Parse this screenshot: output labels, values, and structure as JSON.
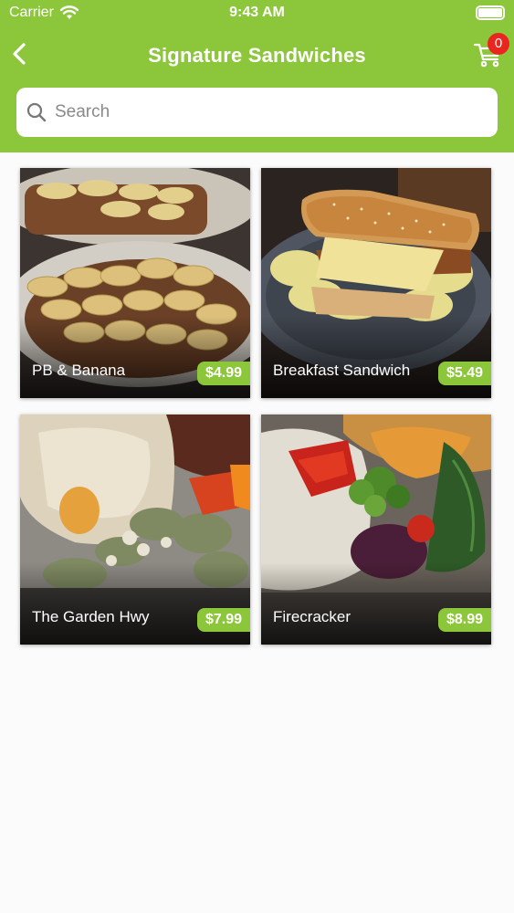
{
  "status_bar": {
    "carrier": "Carrier",
    "time": "9:43 AM"
  },
  "header": {
    "title": "Signature Sandwiches",
    "cart_count": "0"
  },
  "search": {
    "placeholder": "Search"
  },
  "items": [
    {
      "name": "PB & Banana",
      "price": "$4.99"
    },
    {
      "name": "Breakfast Sandwich",
      "price": "$5.49"
    },
    {
      "name": "The Garden Hwy",
      "price": "$7.99"
    },
    {
      "name": "Firecracker",
      "price": "$8.99"
    }
  ],
  "colors": {
    "accent": "#8cc63a",
    "badge": "#e8261f"
  },
  "icons": {
    "back": "chevron-left-icon",
    "cart": "cart-icon",
    "search": "magnifier-icon",
    "wifi": "wifi-icon",
    "battery": "battery-icon"
  }
}
